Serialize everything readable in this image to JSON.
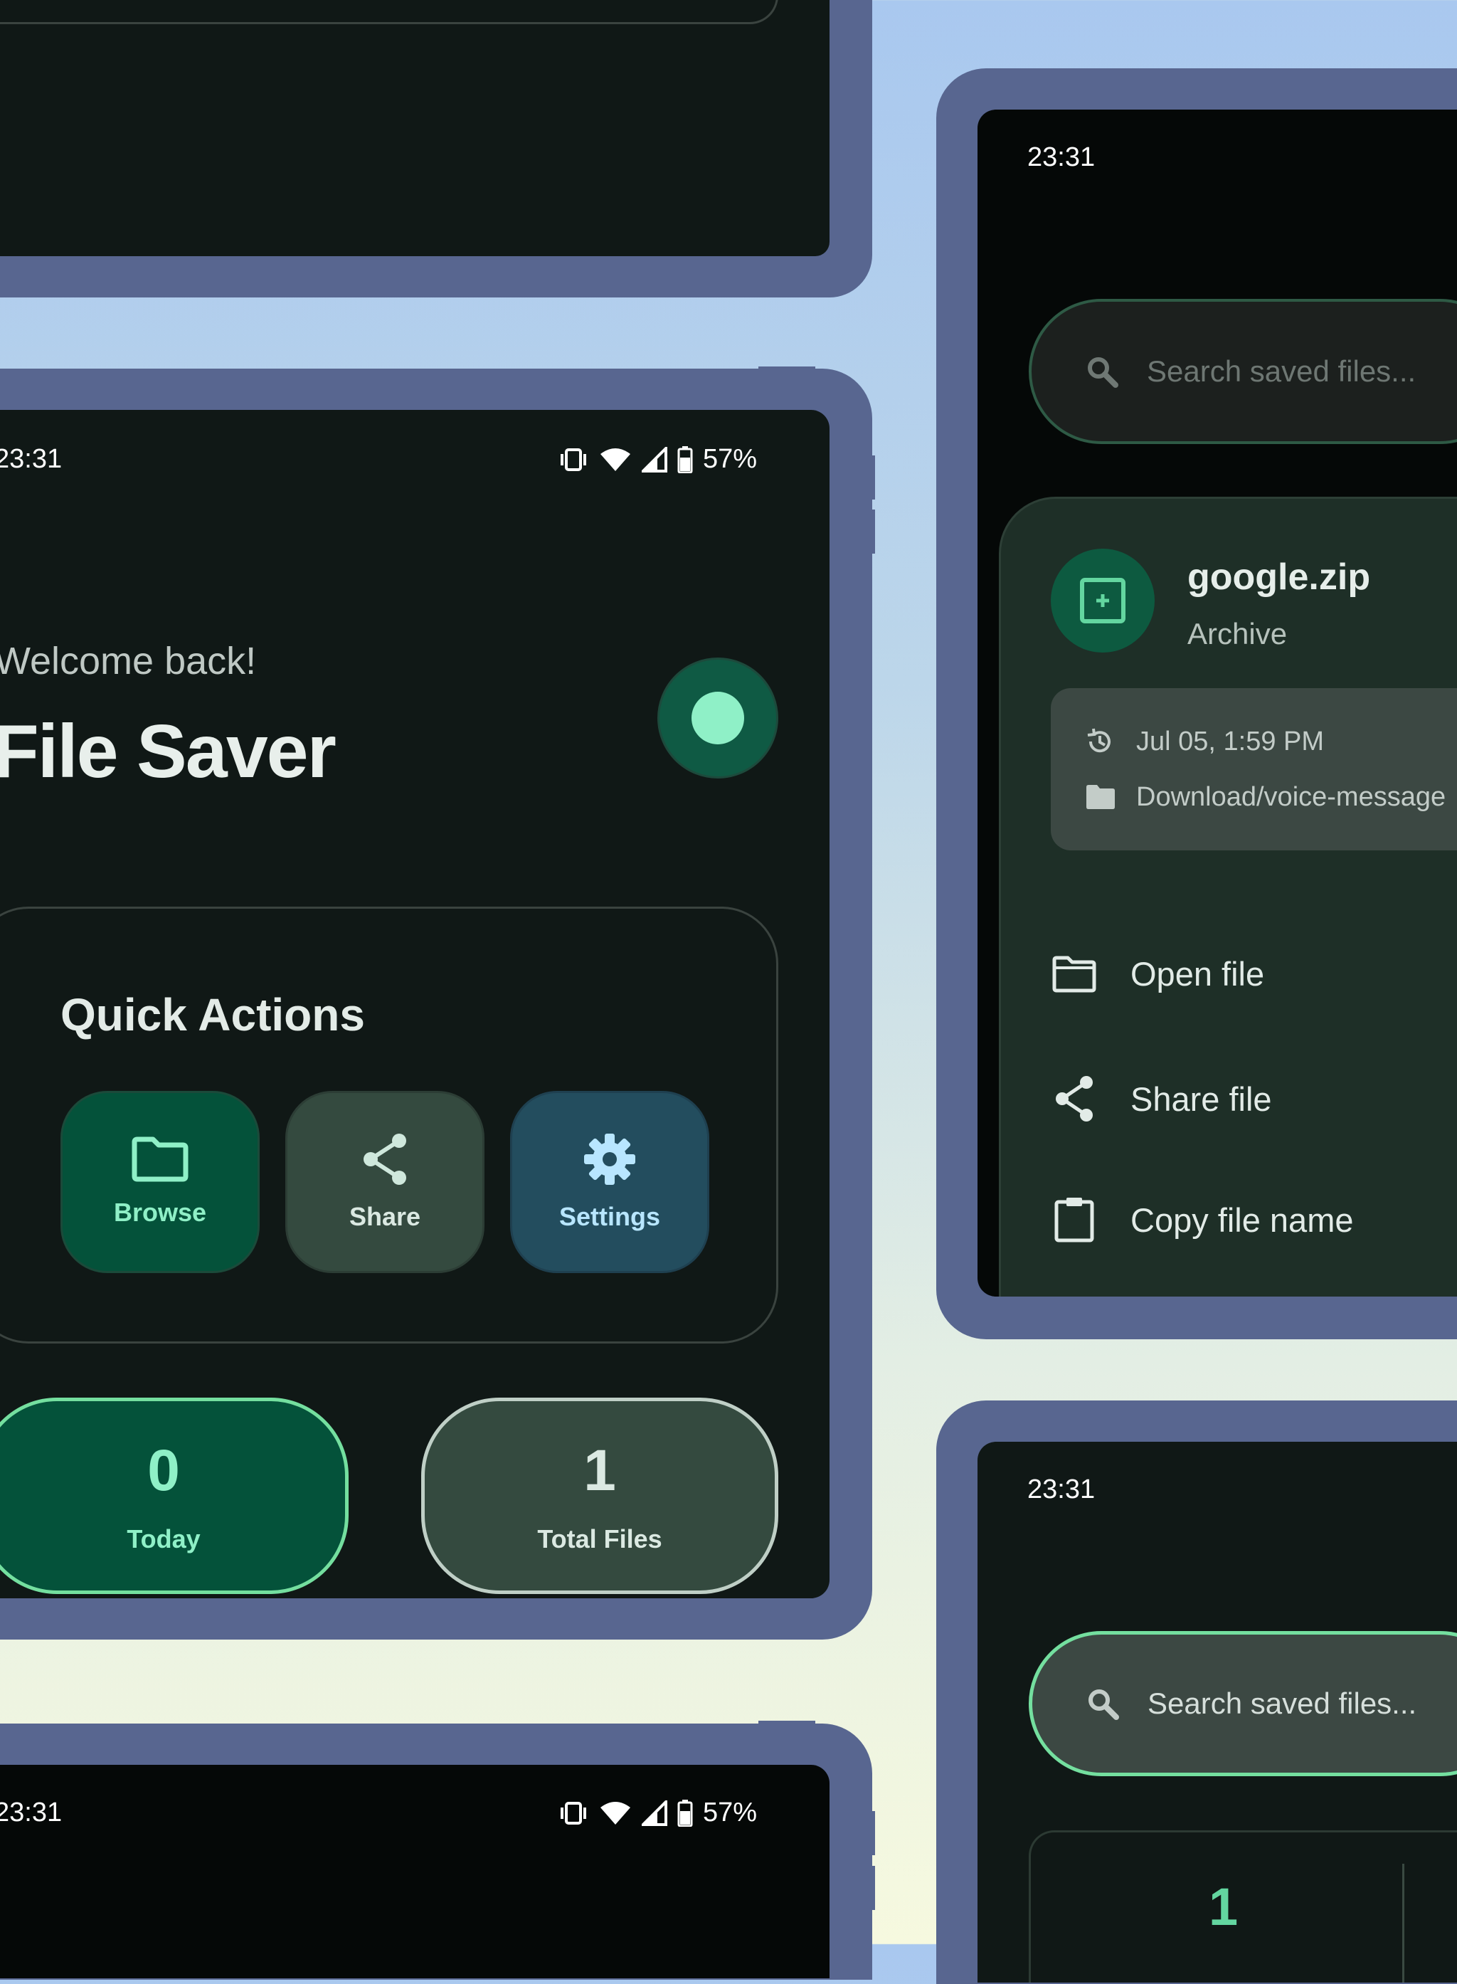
{
  "status_bar": {
    "time": "23:31",
    "battery": "57%"
  },
  "home": {
    "greeting": "Welcome back!",
    "app_title": "File Saver",
    "quick_actions": {
      "title": "Quick Actions",
      "buttons": [
        {
          "label": "Browse",
          "icon": "folder-icon"
        },
        {
          "label": "Share",
          "icon": "share-icon"
        },
        {
          "label": "Settings",
          "icon": "gear-icon"
        }
      ]
    },
    "stats": [
      {
        "value": "0",
        "label": "Today"
      },
      {
        "value": "1",
        "label": "Total Files"
      }
    ]
  },
  "search": {
    "placeholder": "Search saved files..."
  },
  "file_detail": {
    "name": "google.zip",
    "type": "Archive",
    "date": "Jul 05, 1:59 PM",
    "path": "Download/voice-message",
    "actions": [
      {
        "label": "Open file",
        "icon": "folder-outline-icon"
      },
      {
        "label": "Share file",
        "icon": "share-icon"
      },
      {
        "label": "Copy file name",
        "icon": "clipboard-icon"
      }
    ]
  },
  "search_results": {
    "count": "1"
  },
  "colors": {
    "frame": "#586690",
    "screen": "#101816",
    "accent": "#8ff0c7",
    "green_container": "#04523a",
    "share_container": "#344a3f",
    "settings_container": "#234d5e"
  }
}
